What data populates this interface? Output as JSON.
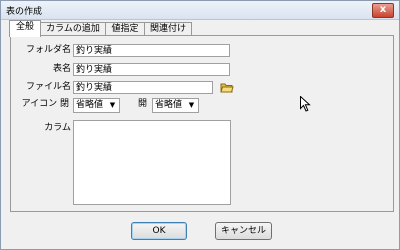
{
  "window": {
    "title": "表の作成",
    "close_glyph": "x"
  },
  "tabs": [
    {
      "label": "全般"
    },
    {
      "label": "カラムの追加"
    },
    {
      "label": "値指定"
    },
    {
      "label": "関連付け"
    }
  ],
  "form": {
    "folder_label": "フォルダ名",
    "folder_value": "釣り実績",
    "table_label": "表名",
    "table_value": "釣り実績",
    "file_label": "ファイル名",
    "file_value": "釣り実績",
    "icon_label": "アイコン 閉",
    "icon_closed_value": "省略値",
    "open_label": "開",
    "icon_open_value": "省略値",
    "column_label": "カラム"
  },
  "buttons": {
    "ok": "OK",
    "cancel": "キャンセル"
  }
}
